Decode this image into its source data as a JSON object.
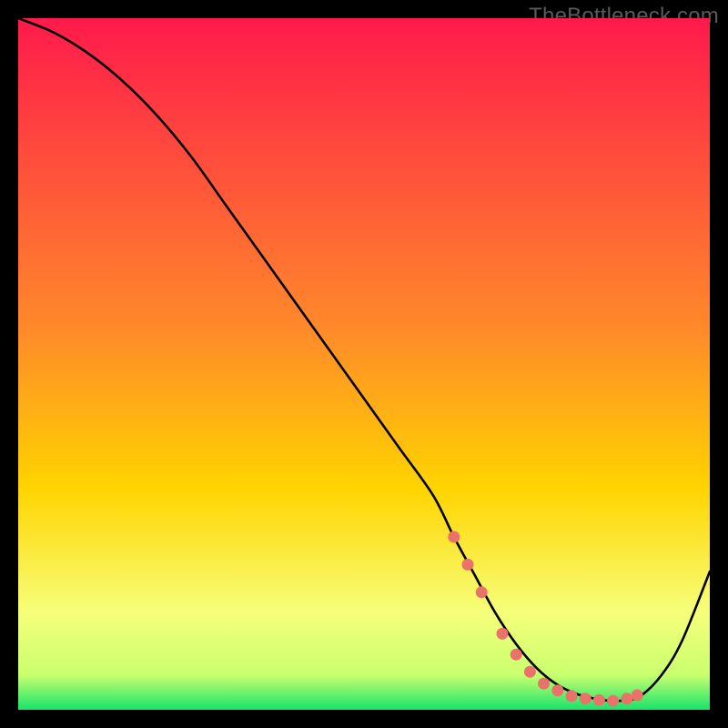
{
  "watermark": "TheBottleneck.com",
  "chart_data": {
    "type": "line",
    "title": "",
    "xlabel": "",
    "ylabel": "",
    "xlim": [
      0,
      100
    ],
    "ylim": [
      0,
      100
    ],
    "background_gradient_top": "#ff1a4b",
    "background_gradient_mid": "#ffd400",
    "background_gradient_low": "#f6ff7a",
    "background_gradient_bottom": "#17e36a",
    "series": [
      {
        "name": "bottleneck-curve",
        "x": [
          0,
          5,
          10,
          15,
          20,
          25,
          30,
          35,
          40,
          45,
          50,
          55,
          60,
          63,
          66,
          69,
          72,
          75,
          78,
          81,
          84,
          86,
          88,
          90,
          93,
          96,
          100
        ],
        "values": [
          100,
          98,
          95,
          91,
          86,
          80,
          73,
          66,
          59,
          52,
          45,
          38,
          31,
          25,
          19.5,
          14,
          9.5,
          6,
          3.6,
          2.2,
          1.5,
          1.3,
          1.4,
          2.0,
          5,
          10,
          20
        ]
      }
    ],
    "marker_points": {
      "name": "highlighted-points",
      "color": "#e9736a",
      "x": [
        63,
        65,
        67,
        70,
        72,
        74,
        76,
        78,
        80,
        82,
        84,
        86,
        88,
        89.5
      ],
      "values": [
        25,
        21,
        17,
        11,
        8,
        5.5,
        3.8,
        2.8,
        2.0,
        1.6,
        1.4,
        1.3,
        1.6,
        2.1
      ]
    }
  }
}
